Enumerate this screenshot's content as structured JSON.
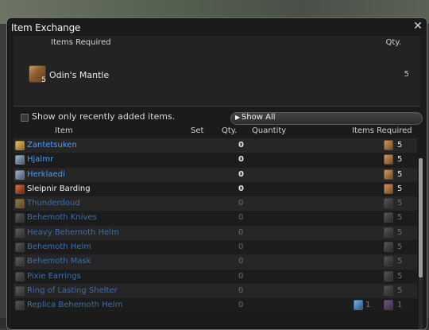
{
  "window": {
    "title": "Item Exchange"
  },
  "required_panel": {
    "items_required_header": "Items Required",
    "qty_header": "Qty.",
    "item": {
      "name": "Odin's Mantle",
      "count": "5",
      "qty": "5"
    }
  },
  "filter": {
    "checkbox_label": "Show only recently added items.",
    "dropdown_label": "Show All"
  },
  "columns": {
    "item": "Item",
    "set": "Set",
    "qty": "Qty.",
    "quantity": "Quantity",
    "items_required": "Items Required"
  },
  "rows": [
    {
      "name": "Zantetsuken",
      "qty": "0",
      "req_count": "5",
      "state": "active",
      "icon": "sword-icon"
    },
    {
      "name": "Hjalmr",
      "qty": "0",
      "req_count": "5",
      "state": "active",
      "icon": "helm-icon"
    },
    {
      "name": "Herklaedi",
      "qty": "0",
      "req_count": "5",
      "state": "active",
      "icon": "armor-icon"
    },
    {
      "name": "Sleipnir Barding",
      "qty": "0",
      "req_count": "5",
      "state": "active",
      "icon": "barding-icon"
    },
    {
      "name": "Thunderdoud",
      "qty": "0",
      "req_count": "5",
      "state": "dim",
      "icon": "weapon-icon"
    },
    {
      "name": "Behemoth Knives",
      "qty": "0",
      "req_count": "5",
      "state": "dim",
      "icon": "knives-icon"
    },
    {
      "name": "Heavy Behemoth Helm",
      "qty": "0",
      "req_count": "5",
      "state": "dim",
      "icon": "helm-icon"
    },
    {
      "name": "Behemoth Helm",
      "qty": "0",
      "req_count": "5",
      "state": "dim",
      "icon": "helm-icon"
    },
    {
      "name": "Behemoth Mask",
      "qty": "0",
      "req_count": "5",
      "state": "dim",
      "icon": "mask-icon"
    },
    {
      "name": "Pixie Earrings",
      "qty": "0",
      "req_count": "5",
      "state": "dim",
      "icon": "earrings-icon"
    },
    {
      "name": "Ring of Lasting Shelter",
      "qty": "0",
      "req_count": "5",
      "state": "dim",
      "icon": "ring-icon"
    },
    {
      "name": "Replica Behemoth Helm",
      "qty": "0",
      "req_count": "1",
      "req2_count": "1",
      "state": "dim",
      "icon": "helm-icon"
    }
  ]
}
